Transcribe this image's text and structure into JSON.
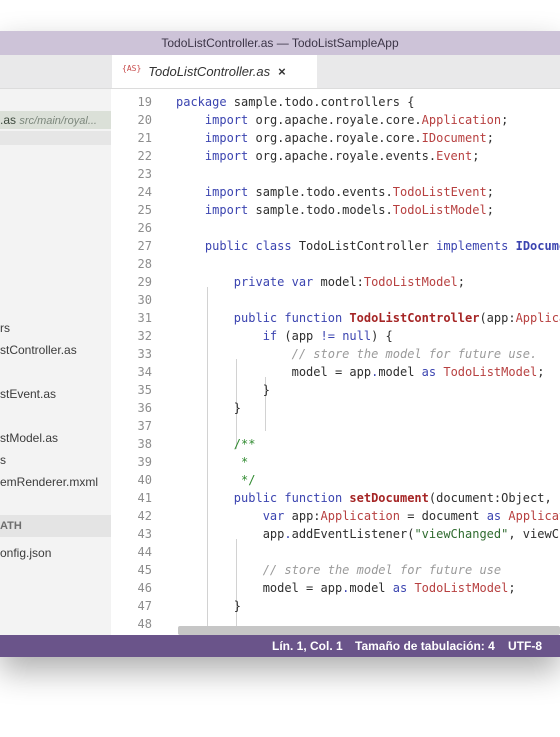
{
  "window": {
    "title": "TodoListController.as — TodoListSampleApp"
  },
  "tabs": [
    {
      "icon_text": "{AS}",
      "label": "TodoListController.as",
      "close": "×"
    }
  ],
  "sidebar": {
    "selected": {
      "name": ".as",
      "path": "src/main/royal..."
    },
    "items": [
      "rs",
      "stController.as",
      "stEvent.as",
      "stModel.as",
      "s",
      "emRenderer.mxml"
    ],
    "section_header": "ATH",
    "section_items": [
      "onfig.json"
    ]
  },
  "editor": {
    "lines": [
      {
        "n": "19",
        "t": [
          [
            "kw",
            "package"
          ],
          [
            "p",
            " sample.todo.controllers {"
          ]
        ]
      },
      {
        "n": "20",
        "t": [
          [
            "p",
            "    "
          ],
          [
            "kw",
            "import"
          ],
          [
            "p",
            " org.apache.royale.core."
          ],
          [
            "type",
            "Application"
          ],
          [
            "p",
            ";"
          ]
        ]
      },
      {
        "n": "21",
        "t": [
          [
            "p",
            "    "
          ],
          [
            "kw",
            "import"
          ],
          [
            "p",
            " org.apache.royale.core."
          ],
          [
            "type",
            "IDocument"
          ],
          [
            "p",
            ";"
          ]
        ]
      },
      {
        "n": "22",
        "t": [
          [
            "p",
            "    "
          ],
          [
            "kw",
            "import"
          ],
          [
            "p",
            " org.apache.royale.events."
          ],
          [
            "type",
            "Event"
          ],
          [
            "p",
            ";"
          ]
        ]
      },
      {
        "n": "23",
        "t": []
      },
      {
        "n": "24",
        "t": [
          [
            "p",
            "    "
          ],
          [
            "kw",
            "import"
          ],
          [
            "p",
            " sample.todo.events."
          ],
          [
            "type",
            "TodoListEvent"
          ],
          [
            "p",
            ";"
          ]
        ]
      },
      {
        "n": "25",
        "t": [
          [
            "p",
            "    "
          ],
          [
            "kw",
            "import"
          ],
          [
            "p",
            " sample.todo.models."
          ],
          [
            "type",
            "TodoListModel"
          ],
          [
            "p",
            ";"
          ]
        ]
      },
      {
        "n": "26",
        "t": []
      },
      {
        "n": "27",
        "t": [
          [
            "p",
            "    "
          ],
          [
            "kw",
            "public class"
          ],
          [
            "p",
            " TodoListController "
          ],
          [
            "kw",
            "implements"
          ],
          [
            "p",
            " "
          ],
          [
            "ifc",
            "IDocume"
          ]
        ]
      },
      {
        "n": "28",
        "t": []
      },
      {
        "n": "29",
        "t": [
          [
            "p",
            "        "
          ],
          [
            "kw",
            "private var"
          ],
          [
            "p",
            " model:"
          ],
          [
            "type",
            "TodoListModel"
          ],
          [
            "p",
            ";"
          ]
        ]
      },
      {
        "n": "30",
        "t": []
      },
      {
        "n": "31",
        "t": [
          [
            "p",
            "        "
          ],
          [
            "kw",
            "public function"
          ],
          [
            "p",
            " "
          ],
          [
            "fn",
            "TodoListController"
          ],
          [
            "p",
            "(app:"
          ],
          [
            "type",
            "Applica"
          ]
        ]
      },
      {
        "n": "32",
        "t": [
          [
            "p",
            "            "
          ],
          [
            "kw",
            "if"
          ],
          [
            "p",
            " (app "
          ],
          [
            "kw",
            "!="
          ],
          [
            "p",
            " "
          ],
          [
            "kw",
            "null"
          ],
          [
            "p",
            ") {"
          ]
        ]
      },
      {
        "n": "33",
        "t": [
          [
            "p",
            "                "
          ],
          [
            "comment",
            "// store the model for future use."
          ]
        ]
      },
      {
        "n": "34",
        "t": [
          [
            "p",
            "                model = app"
          ],
          [
            "kw",
            "."
          ],
          [
            "p",
            "model "
          ],
          [
            "kw",
            "as"
          ],
          [
            "p",
            " "
          ],
          [
            "type",
            "TodoListModel"
          ],
          [
            "p",
            ";"
          ]
        ]
      },
      {
        "n": "35",
        "t": [
          [
            "p",
            "            }"
          ]
        ]
      },
      {
        "n": "36",
        "t": [
          [
            "p",
            "        }"
          ]
        ]
      },
      {
        "n": "37",
        "t": []
      },
      {
        "n": "38",
        "t": [
          [
            "p",
            "        "
          ],
          [
            "doc",
            "/**"
          ]
        ]
      },
      {
        "n": "39",
        "t": [
          [
            "p",
            "         "
          ],
          [
            "doc",
            "*"
          ]
        ]
      },
      {
        "n": "40",
        "t": [
          [
            "p",
            "         "
          ],
          [
            "doc",
            "*/"
          ]
        ]
      },
      {
        "n": "41",
        "t": [
          [
            "p",
            "        "
          ],
          [
            "kw",
            "public function"
          ],
          [
            "p",
            " "
          ],
          [
            "fn",
            "setDocument"
          ],
          [
            "p",
            "(document:Object, "
          ]
        ]
      },
      {
        "n": "42",
        "t": [
          [
            "p",
            "            "
          ],
          [
            "kw",
            "var"
          ],
          [
            "p",
            " app:"
          ],
          [
            "type",
            "Application"
          ],
          [
            "p",
            " = document "
          ],
          [
            "kw",
            "as"
          ],
          [
            "p",
            " "
          ],
          [
            "type",
            "Applicati"
          ]
        ]
      },
      {
        "n": "43",
        "t": [
          [
            "p",
            "            app"
          ],
          [
            "kw",
            "."
          ],
          [
            "p",
            "addEventListener("
          ],
          [
            "str",
            "\"viewChanged\""
          ],
          [
            "p",
            ", viewC"
          ]
        ]
      },
      {
        "n": "44",
        "t": []
      },
      {
        "n": "45",
        "t": [
          [
            "p",
            "            "
          ],
          [
            "comment",
            "// store the model for future use"
          ]
        ]
      },
      {
        "n": "46",
        "t": [
          [
            "p",
            "            model = app"
          ],
          [
            "kw",
            "."
          ],
          [
            "p",
            "model "
          ],
          [
            "kw",
            "as"
          ],
          [
            "p",
            " "
          ],
          [
            "type",
            "TodoListModel"
          ],
          [
            "p",
            ";"
          ]
        ]
      },
      {
        "n": "47",
        "t": [
          [
            "p",
            "        }"
          ]
        ]
      },
      {
        "n": "48",
        "t": []
      }
    ]
  },
  "statusbar": {
    "position": "Lín. 1, Col. 1",
    "tab_size": "Tamaño de tabulación: 4",
    "encoding": "UTF-8"
  },
  "colors": {
    "titlebar": "#cdc3d8",
    "statusbar": "#6a548a",
    "keyword": "#3b44b0",
    "type": "#b74040"
  }
}
